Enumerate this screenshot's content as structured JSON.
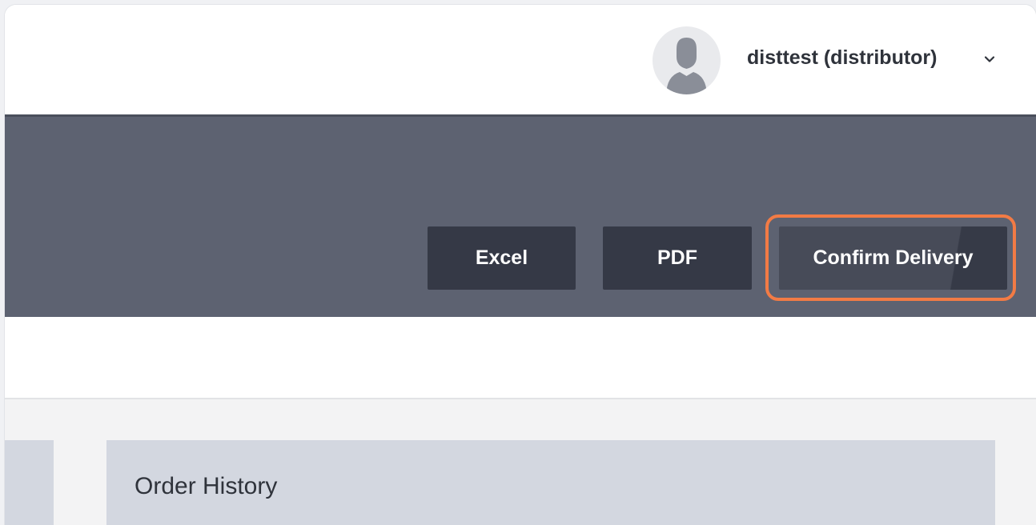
{
  "header": {
    "user_label": "disttest (distributor)",
    "avatar_icon": "user-silhouette-icon",
    "menu_icon": "chevron-down-icon"
  },
  "actions": {
    "excel_label": "Excel",
    "pdf_label": "PDF",
    "confirm_delivery_label": "Confirm Delivery"
  },
  "main": {
    "order_history_title": "Order History"
  },
  "colors": {
    "band": "#5d6271",
    "button": "#353946",
    "highlight": "#f27b45",
    "card": "#d3d7e0"
  }
}
